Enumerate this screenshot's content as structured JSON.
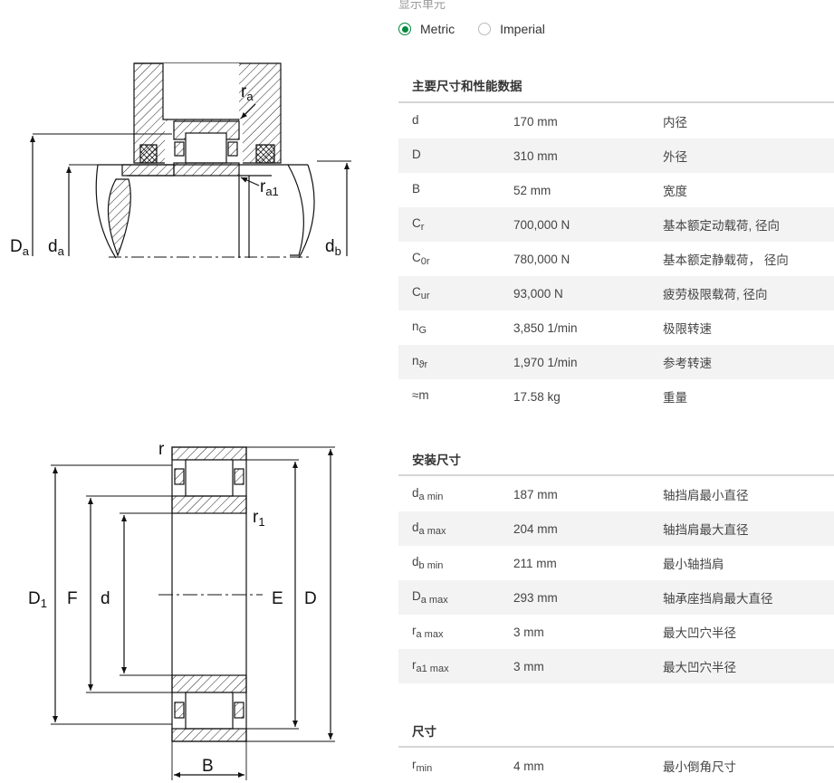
{
  "units": {
    "title": "显示单元",
    "options": [
      {
        "label": "Metric",
        "selected": true
      },
      {
        "label": "Imperial",
        "selected": false
      }
    ],
    "accent_color": "#00893d"
  },
  "drawings": {
    "top": {
      "labels": {
        "ra": "r",
        "ra_sub": "a",
        "ra1": "r",
        "ra1_sub": "a1",
        "Da": "D",
        "Da_sub": "a",
        "da": "d",
        "da_sub": "a",
        "db": "d",
        "db_sub": "b"
      }
    },
    "bottom": {
      "labels": {
        "r": "r",
        "r1": "r",
        "r1_sub": "1",
        "D1": "D",
        "D1_sub": "1",
        "F": "F",
        "d": "d",
        "E": "E",
        "D": "D",
        "B": "B"
      }
    }
  },
  "sections": [
    {
      "title": "主要尺寸和性能数据",
      "rows": [
        {
          "sym": "d",
          "sub": "",
          "value": "170 mm",
          "desc": "内径"
        },
        {
          "sym": "D",
          "sub": "",
          "value": "310 mm",
          "desc": "外径"
        },
        {
          "sym": "B",
          "sub": "",
          "value": "52 mm",
          "desc": "宽度"
        },
        {
          "sym": "C",
          "sub": "r",
          "value": "700,000 N",
          "desc": "基本额定动载荷, 径向"
        },
        {
          "sym": "C",
          "sub": "0r",
          "value": "780,000 N",
          "desc": "基本额定静载荷， 径向"
        },
        {
          "sym": "C",
          "sub": "ur",
          "value": "93,000 N",
          "desc": "疲劳极限载荷, 径向"
        },
        {
          "sym": "n",
          "sub": "G",
          "value": "3,850 1/min",
          "desc": "极限转速"
        },
        {
          "sym": "n",
          "sub": "ϑr",
          "value": "1,970 1/min",
          "desc": "参考转速"
        },
        {
          "sym": "≈m",
          "sub": "",
          "value": "17.58 kg",
          "desc": "重量"
        }
      ]
    },
    {
      "title": "安装尺寸",
      "rows": [
        {
          "sym": "d",
          "sub": "a min",
          "value": "187 mm",
          "desc": "轴挡肩最小直径"
        },
        {
          "sym": "d",
          "sub": "a max",
          "value": "204 mm",
          "desc": "轴挡肩最大直径"
        },
        {
          "sym": "d",
          "sub": "b min",
          "value": "211 mm",
          "desc": "最小轴挡肩"
        },
        {
          "sym": "D",
          "sub": "a max",
          "value": "293 mm",
          "desc": "轴承座挡肩最大直径"
        },
        {
          "sym": "r",
          "sub": "a max",
          "value": "3 mm",
          "desc": "最大凹穴半径"
        },
        {
          "sym": "r",
          "sub": "a1 max",
          "value": "3 mm",
          "desc": "最大凹穴半径"
        }
      ]
    },
    {
      "title": "尺寸",
      "rows": [
        {
          "sym": "r",
          "sub": "min",
          "value": "4 mm",
          "desc": "最小倒角尺寸"
        }
      ]
    }
  ]
}
